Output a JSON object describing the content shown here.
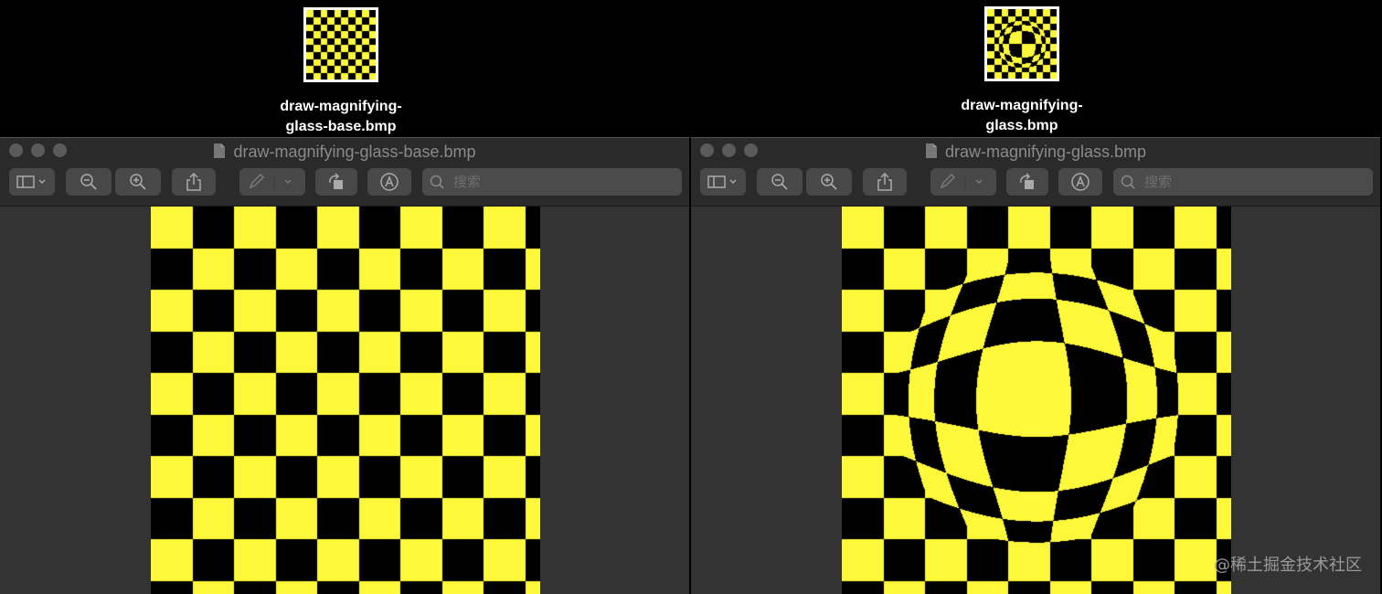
{
  "desktop": {
    "icons": [
      {
        "line1": "draw-magnifying-",
        "line2": "glass-base.bmp"
      },
      {
        "line1": "draw-magnifying-",
        "line2": "glass.bmp"
      }
    ]
  },
  "windows": [
    {
      "title": "draw-magnifying-glass-base.bmp",
      "search_placeholder": "搜索"
    },
    {
      "title": "draw-magnifying-glass.bmp",
      "search_placeholder": "搜索"
    }
  ],
  "colors": {
    "checker_yellow": "#fdf83a",
    "checker_black": "#000000"
  },
  "icons": [
    "sidebar-icon",
    "chevron-down-icon",
    "zoom-out-icon",
    "zoom-in-icon",
    "share-icon",
    "markup-pen-icon",
    "rotate-icon",
    "markup-toolbar-icon",
    "search-icon",
    "document-icon"
  ],
  "watermark": "@稀土掘金技术社区"
}
